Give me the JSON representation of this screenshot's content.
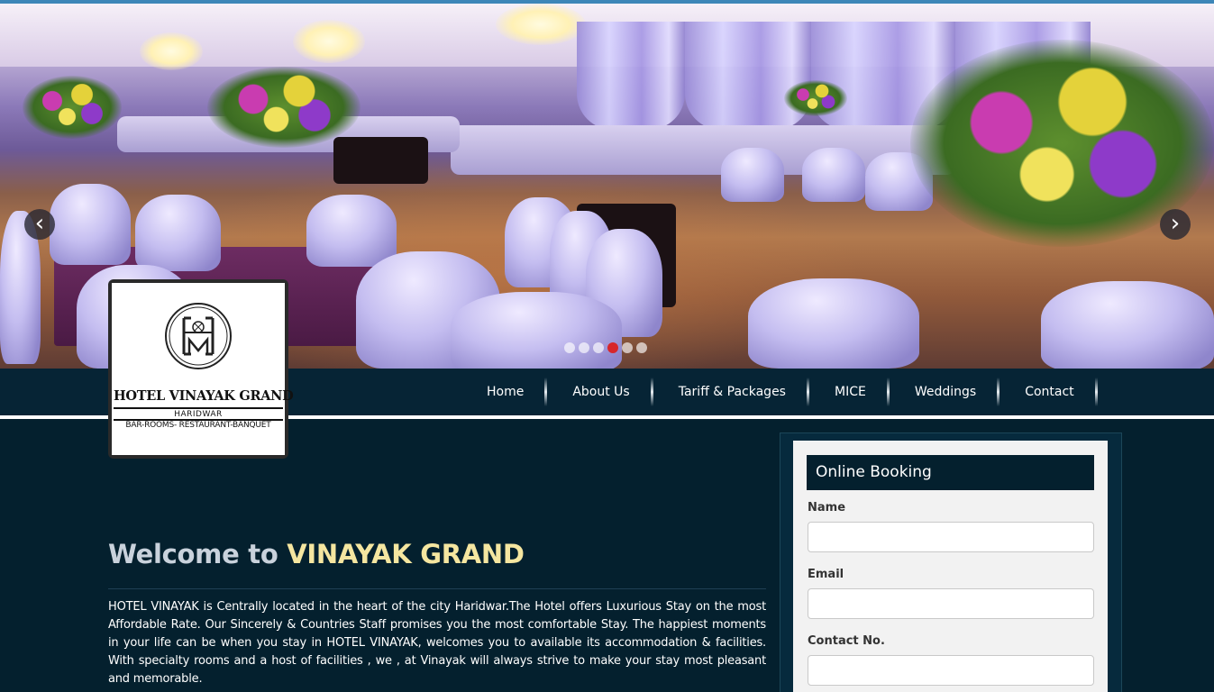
{
  "slider": {
    "prev_icon": "chevron-left-icon",
    "next_icon": "chevron-right-icon",
    "prev_glyph": "‹",
    "next_glyph": "›",
    "slide_count": 6,
    "active_slide": 4,
    "active_color": "#d7262a"
  },
  "logo": {
    "title": "HOTEL VINAYAK GRAND",
    "city": "HARIDWAR",
    "tagline": "BAR-ROOMS- RESTAURANT-BANQUET"
  },
  "nav": {
    "items": [
      "Home",
      "About Us",
      "Tariff & Packages",
      "MICE",
      "Weddings",
      "Contact"
    ]
  },
  "welcome": {
    "prefix": "Welcome to ",
    "brand": "VINAYAK GRAND",
    "text": "HOTEL VINAYAK is Centrally located in the heart of the city Haridwar.The Hotel offers Luxurious Stay on the most Affordable Rate. Our Sincerely & Countries Staff promises you the most comfortable Stay. The happiest moments in your life can be when you stay in HOTEL VINAYAK, welcomes you to available its accommodation & facilities. With specialty rooms and a host of facilities , we , at Vinayak will always strive to make your stay most pleasant and memorable."
  },
  "booking": {
    "title": "Online Booking",
    "fields": [
      {
        "label": "Name",
        "value": "",
        "placeholder": ""
      },
      {
        "label": "Email",
        "value": "",
        "placeholder": ""
      },
      {
        "label": "Contact No.",
        "value": "",
        "placeholder": ""
      }
    ]
  },
  "colors": {
    "page_bg": "#04202e",
    "nav_bg": "#062435",
    "brand_accent": "#f5e6a0",
    "card_bg": "#f2f2f2"
  }
}
